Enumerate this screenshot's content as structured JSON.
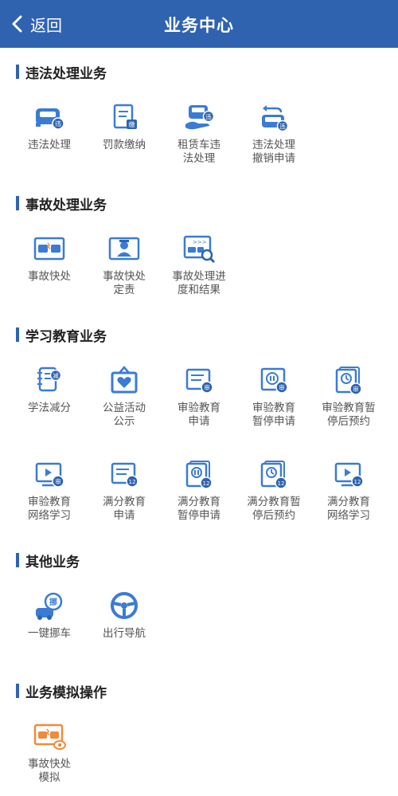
{
  "header": {
    "back_label": "返回",
    "title": "业务中心"
  },
  "colors": {
    "brand": "#2f63b0",
    "icon_blue": "#3a7bd5",
    "icon_orange": "#f08a3c"
  },
  "sections": [
    {
      "title": "违法处理业务",
      "items": [
        {
          "label": "违法处理",
          "icon": "car-violation-icon",
          "badge": "违"
        },
        {
          "label": "罚款缴纳",
          "icon": "fine-payment-icon",
          "badge": "缴"
        },
        {
          "label": "租赁车违\n法处理",
          "icon": "rental-car-violation-icon",
          "badge": "违"
        },
        {
          "label": "违法处理\n撤销申请",
          "icon": "violation-revoke-icon",
          "badge": "违"
        }
      ]
    },
    {
      "title": "事故处理业务",
      "items": [
        {
          "label": "事故快处",
          "icon": "accident-quick-icon"
        },
        {
          "label": "事故快处\n定责",
          "icon": "accident-liability-icon"
        },
        {
          "label": "事故处理进\n度和结果",
          "icon": "accident-progress-icon"
        }
      ]
    },
    {
      "title": "学习教育业务",
      "items": [
        {
          "label": "学法减分",
          "icon": "study-reduce-points-icon",
          "badge": "减"
        },
        {
          "label": "公益活动\n公示",
          "icon": "public-welfare-icon"
        },
        {
          "label": "审验教育\n申请",
          "icon": "review-education-apply-icon",
          "badge": "审"
        },
        {
          "label": "审验教育\n暂停申请",
          "icon": "review-education-pause-icon",
          "badge": "审"
        },
        {
          "label": "审验教育暂\n停后预约",
          "icon": "review-education-appointment-icon",
          "badge": "审"
        },
        {
          "label": "审验教育\n网络学习",
          "icon": "review-education-online-icon",
          "badge": "审"
        },
        {
          "label": "满分教育\n申请",
          "icon": "full-score-apply-icon",
          "badge": "12"
        },
        {
          "label": "满分教育\n暂停申请",
          "icon": "full-score-pause-icon",
          "badge": "12"
        },
        {
          "label": "满分教育暂\n停后预约",
          "icon": "full-score-appointment-icon",
          "badge": "12"
        },
        {
          "label": "满分教育\n网络学习",
          "icon": "full-score-online-icon",
          "badge": "12"
        }
      ]
    },
    {
      "title": "其他业务",
      "items": [
        {
          "label": "一键挪车",
          "icon": "move-car-icon",
          "badge": "挪"
        },
        {
          "label": "出行导航",
          "icon": "navigation-icon"
        }
      ]
    },
    {
      "title": "业务模拟操作",
      "items": [
        {
          "label": "事故快处\n模拟",
          "icon": "accident-simulation-icon"
        }
      ]
    }
  ]
}
